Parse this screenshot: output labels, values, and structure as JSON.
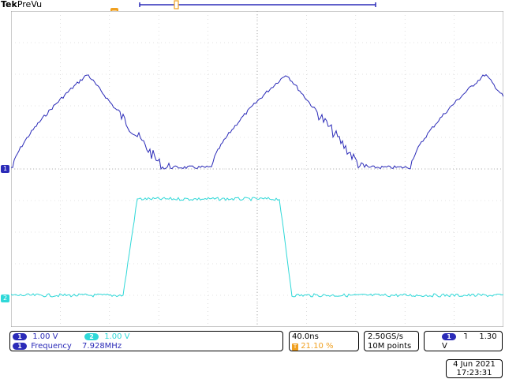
{
  "header": {
    "brand": "Tek",
    "mode": "PreVu"
  },
  "colors": {
    "ch1": "#2b2bb8",
    "ch2": "#2fd8d8",
    "trigger": "#f0a020",
    "grid": "#9a9a9a"
  },
  "markers": {
    "ch1_label": "1",
    "ch2_label": "2",
    "trigger_label": "T"
  },
  "status": {
    "ch1_num": "1",
    "ch1_scale": "1.00 V",
    "ch2_num": "2",
    "ch2_scale": "1.00 V",
    "meas_num": "1",
    "meas_name": "Frequency",
    "meas_value": "7.928MHz",
    "timebase": "40.0ns",
    "trig_pos_icon": "T",
    "trig_pos": "21.10 %",
    "sample_rate": "2.50GS/s",
    "record_length": "10M points",
    "trig_src": "1",
    "trig_slope": "˥",
    "trig_level": "1.30 V"
  },
  "datetime": {
    "date": "4 Jun  2021",
    "time": "17:23:31"
  }
}
